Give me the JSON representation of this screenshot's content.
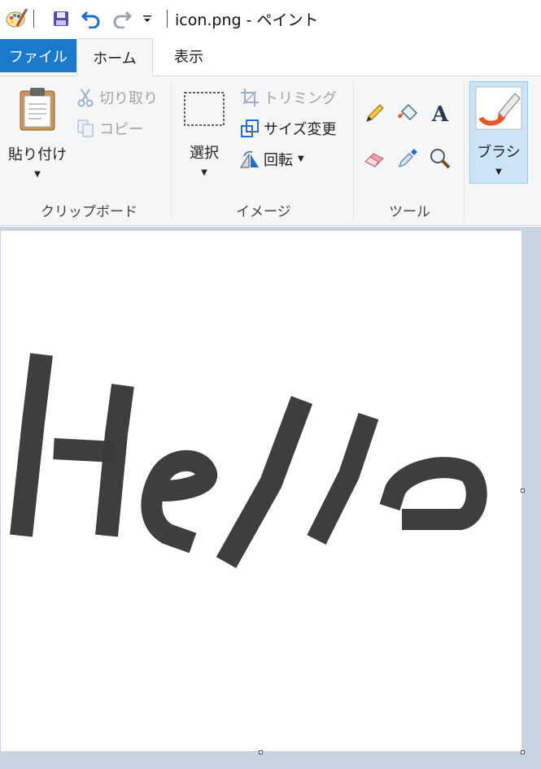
{
  "window": {
    "title": "icon.png - ペイント"
  },
  "quick_access": {
    "app_icon": "paint-palette-icon",
    "save_icon": "save-icon",
    "undo_icon": "undo-icon",
    "redo_icon": "redo-icon",
    "customize_icon": "customize-dropdown-icon"
  },
  "tabs": [
    {
      "label": "ファイル"
    },
    {
      "label": "ホーム"
    },
    {
      "label": "表示"
    }
  ],
  "ribbon": {
    "clipboard": {
      "label": "クリップボード",
      "paste_label": "貼り付け",
      "cut_label": "切り取り",
      "copy_label": "コピー"
    },
    "image": {
      "label": "イメージ",
      "select_label": "選択",
      "crop_label": "トリミング",
      "resize_label": "サイズ変更",
      "rotate_label": "回転"
    },
    "tools": {
      "label": "ツール",
      "items": [
        "pencil-icon",
        "fill-bucket-icon",
        "text-icon",
        "eraser-icon",
        "color-picker-icon",
        "magnifier-icon"
      ]
    },
    "brushes": {
      "label": "ブラシ"
    }
  },
  "canvas": {
    "drawing": "Hello",
    "stroke_color": "#3a3a3a",
    "background_color": "#ffffff"
  },
  "colors": {
    "file_tab": "#1979ca",
    "ribbon_bg": "#f5f6f7",
    "workspace_bg": "#c9d3e2",
    "selected_button": "#cce4f7"
  }
}
